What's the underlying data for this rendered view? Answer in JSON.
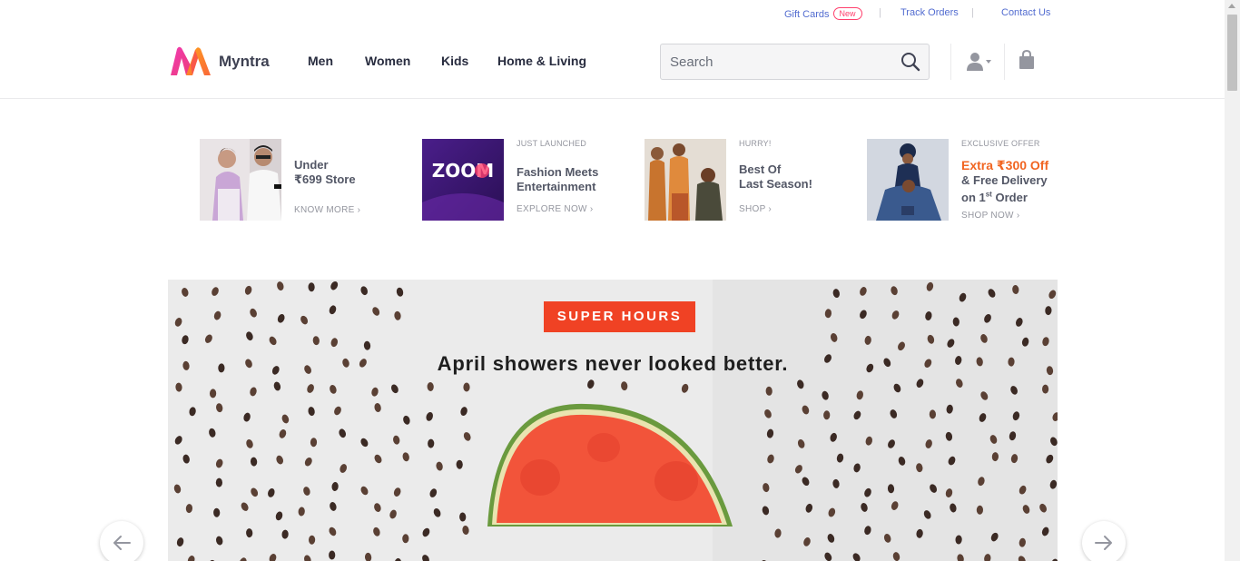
{
  "topbar": {
    "gift_cards": "Gift Cards",
    "new_badge": "New",
    "track_orders": "Track Orders",
    "contact_us": "Contact Us",
    "separator": "|"
  },
  "header": {
    "brand": "Myntra",
    "nav": [
      "Men",
      "Women",
      "Kids",
      "Home & Living"
    ],
    "search_placeholder": "Search",
    "icons": [
      "search-icon",
      "user-icon",
      "bag-icon"
    ]
  },
  "promos": [
    {
      "tag": "",
      "title_line1": "Under",
      "title_line2": "₹699 Store",
      "cta": "KNOW MORE ›"
    },
    {
      "tag": "JUST LAUNCHED",
      "title_line1": "Fashion Meets",
      "title_line2": "Entertainment",
      "cta": "EXPLORE NOW ›",
      "image_text": "ZOOM"
    },
    {
      "tag": "HURRY!",
      "title_line1": "Best Of",
      "title_line2": "Last Season!",
      "cta": "SHOP ›"
    },
    {
      "tag": "EXCLUSIVE OFFER",
      "highlight": "Extra ₹300 Off",
      "title_line2": "& Free Delivery",
      "title_line3_prefix": "on 1",
      "title_line3_sup": "st",
      "title_line3_suffix": " Order",
      "cta": "SHOP NOW ›"
    }
  ],
  "hero": {
    "badge": "SUPER HOURS",
    "headline": "April showers never looked better."
  },
  "carousel": {
    "prev": "previous-arrow",
    "next": "next-arrow"
  },
  "colors": {
    "accent_pink": "#ff3f6c",
    "link_blue": "#526cd0",
    "offer_orange": "#f16521",
    "hero_badge": "#f04224"
  }
}
